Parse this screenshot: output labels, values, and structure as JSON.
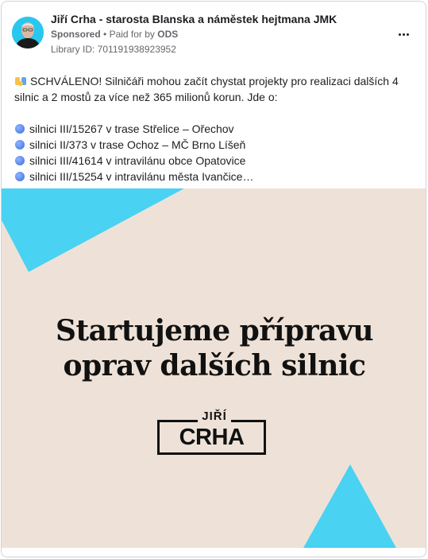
{
  "post": {
    "page_name": "Jiří Crha - starosta Blanska a náměstek hejtmana JMK",
    "sponsored_label": "Sponsored",
    "separator": "•",
    "paid_for_label": "Paid for by",
    "paid_for_by": "ODS",
    "library_id": "Library ID: 701191938923952",
    "text_line1": "SCHVÁLENO! Silničáři mohou začít chystat projekty pro realizaci dalších 4 silnic a 2 mostů za více než 365 milionů korun. Jde o:",
    "bullets": [
      "silnici III/15267 v trase Střelice – Ořechov",
      "silnici II/373 v trase Ochoz – MČ Brno Líšeň",
      "silnici III/41614 v intravilánu obce Opatovice",
      "silnici III/15254 v intravilánu města Ivančice…"
    ],
    "icons": {
      "more": "more-horizontal-icon",
      "raise_hand": "raising-hands-emoji",
      "bullet": "blue-circle-emoji"
    }
  },
  "ad_image": {
    "headline_line1": "Startujeme přípravu",
    "headline_line2": "oprav dalších silnic",
    "logo_first_name": "JIŘÍ",
    "logo_last_name": "CRHA",
    "colors": {
      "background": "#eee2d8",
      "accent": "#49d2f2",
      "text": "#111111"
    }
  }
}
